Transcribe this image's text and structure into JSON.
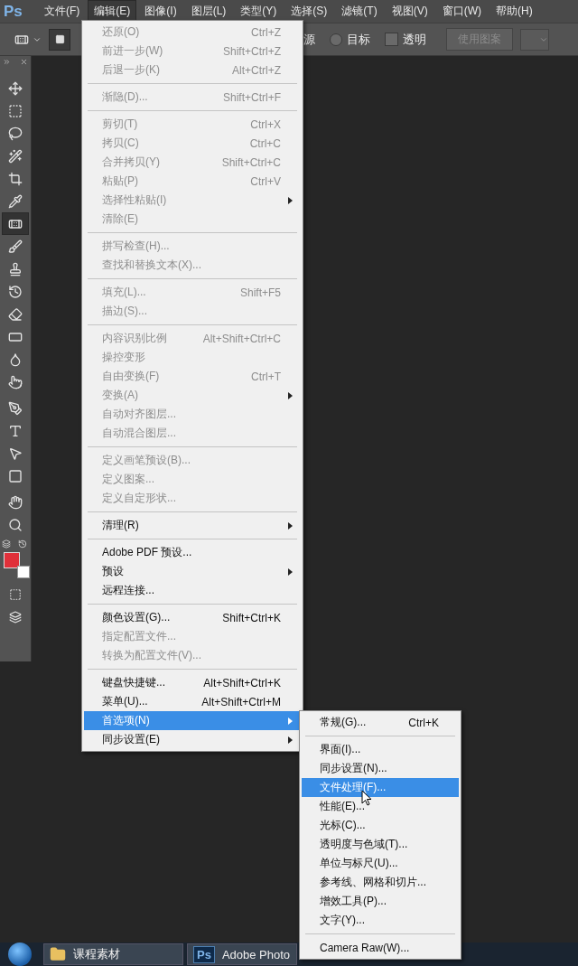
{
  "app_logo": "Ps",
  "menubar": [
    {
      "label": "文件(F)",
      "selected": false
    },
    {
      "label": "编辑(E)",
      "selected": true
    },
    {
      "label": "图像(I)",
      "selected": false
    },
    {
      "label": "图层(L)",
      "selected": false
    },
    {
      "label": "类型(Y)",
      "selected": false
    },
    {
      "label": "选择(S)",
      "selected": false
    },
    {
      "label": "滤镜(T)",
      "selected": false
    },
    {
      "label": "视图(V)",
      "selected": false
    },
    {
      "label": "窗口(W)",
      "selected": false
    },
    {
      "label": "帮助(H)",
      "selected": false
    }
  ],
  "options_bar": {
    "source_label": "源",
    "target_radio": {
      "label": "目标",
      "selected": false
    },
    "transparent_checkbox": {
      "label": "透明",
      "checked": false
    },
    "use_pattern_button": {
      "label": "使用图案",
      "disabled": true
    }
  },
  "tools": [
    {
      "kind": "move",
      "selected": false
    },
    {
      "kind": "marquee",
      "selected": false
    },
    {
      "kind": "lasso",
      "selected": false
    },
    {
      "kind": "wand",
      "selected": false
    },
    {
      "kind": "crop",
      "selected": false
    },
    {
      "kind": "eyedropper",
      "selected": false
    },
    {
      "kind": "patch",
      "selected": true
    },
    {
      "kind": "brush",
      "selected": false
    },
    {
      "kind": "stamp",
      "selected": false
    },
    {
      "kind": "history",
      "selected": false
    },
    {
      "kind": "eraser",
      "selected": false
    },
    {
      "kind": "gradient",
      "selected": false
    },
    {
      "kind": "blur",
      "selected": false
    },
    {
      "kind": "dodge",
      "selected": false
    },
    {
      "kind": "pen",
      "selected": false
    },
    {
      "kind": "type",
      "selected": false
    },
    {
      "kind": "path",
      "selected": false
    },
    {
      "kind": "shape",
      "selected": false
    },
    {
      "kind": "hand",
      "selected": false
    },
    {
      "kind": "zoom",
      "selected": false
    }
  ],
  "swatches": [
    {
      "kind": "foreground",
      "color": "#e0303a"
    },
    {
      "kind": "background",
      "color": "#ffffff"
    }
  ],
  "edit_menu": {
    "groups": [
      {
        "items": [
          {
            "label": "还原(O)",
            "shortcut": "Ctrl+Z",
            "disabled": true,
            "submenu": false,
            "selected": false
          },
          {
            "label": "前进一步(W)",
            "shortcut": "Shift+Ctrl+Z",
            "disabled": true,
            "submenu": false,
            "selected": false
          },
          {
            "label": "后退一步(K)",
            "shortcut": "Alt+Ctrl+Z",
            "disabled": true,
            "submenu": false,
            "selected": false
          }
        ]
      },
      {
        "items": [
          {
            "label": "渐隐(D)...",
            "shortcut": "Shift+Ctrl+F",
            "disabled": true,
            "submenu": false,
            "selected": false
          }
        ]
      },
      {
        "items": [
          {
            "label": "剪切(T)",
            "shortcut": "Ctrl+X",
            "disabled": true,
            "submenu": false,
            "selected": false
          },
          {
            "label": "拷贝(C)",
            "shortcut": "Ctrl+C",
            "disabled": true,
            "submenu": false,
            "selected": false
          },
          {
            "label": "合并拷贝(Y)",
            "shortcut": "Shift+Ctrl+C",
            "disabled": true,
            "submenu": false,
            "selected": false
          },
          {
            "label": "粘贴(P)",
            "shortcut": "Ctrl+V",
            "disabled": true,
            "submenu": false,
            "selected": false
          },
          {
            "label": "选择性粘贴(I)",
            "disabled": true,
            "submenu": true,
            "selected": false
          },
          {
            "label": "清除(E)",
            "disabled": true,
            "submenu": false,
            "selected": false
          }
        ]
      },
      {
        "items": [
          {
            "label": "拼写检查(H)...",
            "disabled": true,
            "submenu": false,
            "selected": false
          },
          {
            "label": "查找和替换文本(X)...",
            "disabled": true,
            "submenu": false,
            "selected": false
          }
        ]
      },
      {
        "items": [
          {
            "label": "填充(L)...",
            "shortcut": "Shift+F5",
            "disabled": true,
            "submenu": false,
            "selected": false
          },
          {
            "label": "描边(S)...",
            "disabled": true,
            "submenu": false,
            "selected": false
          }
        ]
      },
      {
        "items": [
          {
            "label": "内容识别比例",
            "shortcut": "Alt+Shift+Ctrl+C",
            "disabled": true,
            "submenu": false,
            "selected": false
          },
          {
            "label": "操控变形",
            "disabled": true,
            "submenu": false,
            "selected": false
          },
          {
            "label": "自由变换(F)",
            "shortcut": "Ctrl+T",
            "disabled": true,
            "submenu": false,
            "selected": false
          },
          {
            "label": "变换(A)",
            "disabled": true,
            "submenu": true,
            "selected": false
          },
          {
            "label": "自动对齐图层...",
            "disabled": true,
            "submenu": false,
            "selected": false
          },
          {
            "label": "自动混合图层...",
            "disabled": true,
            "submenu": false,
            "selected": false
          }
        ]
      },
      {
        "items": [
          {
            "label": "定义画笔预设(B)...",
            "disabled": true,
            "submenu": false,
            "selected": false
          },
          {
            "label": "定义图案...",
            "disabled": true,
            "submenu": false,
            "selected": false
          },
          {
            "label": "定义自定形状...",
            "disabled": true,
            "submenu": false,
            "selected": false
          }
        ]
      },
      {
        "items": [
          {
            "label": "清理(R)",
            "disabled": false,
            "submenu": true,
            "selected": false
          }
        ]
      },
      {
        "items": [
          {
            "label": "Adobe PDF 预设...",
            "disabled": false,
            "submenu": false,
            "selected": false
          },
          {
            "label": "预设",
            "disabled": false,
            "submenu": true,
            "selected": false
          },
          {
            "label": "远程连接...",
            "disabled": false,
            "submenu": false,
            "selected": false
          }
        ]
      },
      {
        "items": [
          {
            "label": "颜色设置(G)...",
            "shortcut": "Shift+Ctrl+K",
            "disabled": false,
            "submenu": false,
            "selected": false
          },
          {
            "label": "指定配置文件...",
            "disabled": true,
            "submenu": false,
            "selected": false
          },
          {
            "label": "转换为配置文件(V)...",
            "disabled": true,
            "submenu": false,
            "selected": false
          }
        ]
      },
      {
        "items": [
          {
            "label": "键盘快捷键...",
            "shortcut": "Alt+Shift+Ctrl+K",
            "disabled": false,
            "submenu": false,
            "selected": false
          },
          {
            "label": "菜单(U)...",
            "shortcut": "Alt+Shift+Ctrl+M",
            "disabled": false,
            "submenu": false,
            "selected": false
          },
          {
            "label": "首选项(N)",
            "disabled": false,
            "submenu": true,
            "selected": true
          },
          {
            "label": "同步设置(E)",
            "disabled": false,
            "submenu": true,
            "selected": false
          }
        ]
      }
    ]
  },
  "preferences_submenu": {
    "groups": [
      {
        "items": [
          {
            "label": "常规(G)...",
            "shortcut": "Ctrl+K",
            "selected": false
          }
        ]
      },
      {
        "items": [
          {
            "label": "界面(I)...",
            "selected": false
          },
          {
            "label": "同步设置(N)...",
            "selected": false
          },
          {
            "label": "文件处理(F)...",
            "selected": true
          },
          {
            "label": "性能(E)...",
            "selected": false
          },
          {
            "label": "光标(C)...",
            "selected": false
          },
          {
            "label": "透明度与色域(T)...",
            "selected": false
          },
          {
            "label": "单位与标尺(U)...",
            "selected": false
          },
          {
            "label": "参考线、网格和切片...",
            "selected": false
          },
          {
            "label": "增效工具(P)...",
            "selected": false
          },
          {
            "label": "文字(Y)...",
            "selected": false
          }
        ]
      },
      {
        "items": [
          {
            "label": "Camera Raw(W)...",
            "selected": false
          }
        ]
      }
    ]
  },
  "taskbar": {
    "items": [
      {
        "kind": "folder",
        "label": "课程素材"
      },
      {
        "kind": "photoshop",
        "logo": "Ps",
        "label": "Adobe Photo"
      }
    ]
  }
}
